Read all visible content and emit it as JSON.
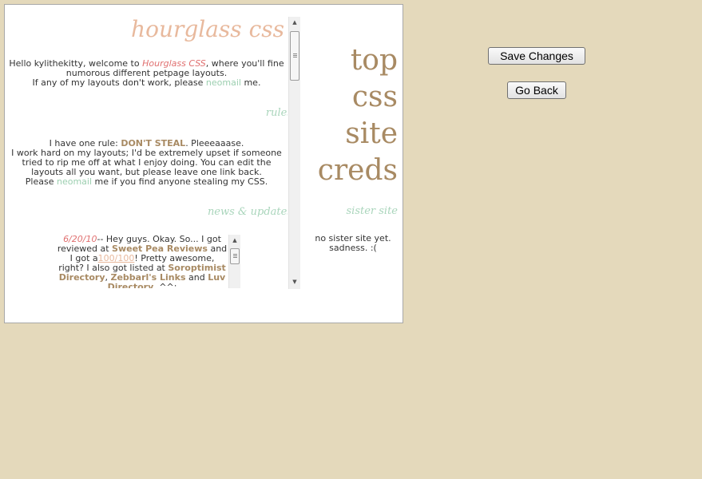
{
  "title": "hourglass css",
  "intro": {
    "line1_a": "Hello kylithekitty, welcome to ",
    "line1_link": "Hourglass CSS",
    "line1_b": ", where you'll fine numorous different petpage layouts.",
    "line2_a": "If any of my layouts don't work, please ",
    "line2_link": "neomail",
    "line2_b": " me."
  },
  "rules": {
    "heading": "rules",
    "p1_a": "I have one rule: ",
    "p1_strong": "DON'T STEAL",
    "p1_b": ". Pleeeaaase.",
    "p2": "I work hard on my layouts; I'd be extremely upset if someone tried to rip me off at what I enjoy doing. You can edit the layouts all you want, but please leave one link back.",
    "p3_a": "Please ",
    "p3_link": "neomail",
    "p3_b": " me if you find anyone stealing my CSS."
  },
  "news": {
    "heading": "news & updates",
    "date": "6/20/10",
    "t1": "-- Hey guys. Okay. So... I got reviewed at ",
    "link1": "Sweet Pea Reviews",
    "t2": " and I got a",
    "link_score": "100/100",
    "t3": "! Pretty awesome, right? I also got listed at ",
    "link2": "Soroptimist Directory",
    "t4": ", ",
    "link3": "Zebbarl's Links",
    "t5": " and ",
    "link4": "Luv Directory",
    "t6": ". ^^;"
  },
  "side": {
    "words": [
      "top",
      "css",
      "site",
      "creds"
    ],
    "sister_heading": "sister site",
    "sister_text": "no sister site yet. sadness. :("
  },
  "buttons": {
    "save": "Save Changes",
    "back": "Go Back"
  }
}
